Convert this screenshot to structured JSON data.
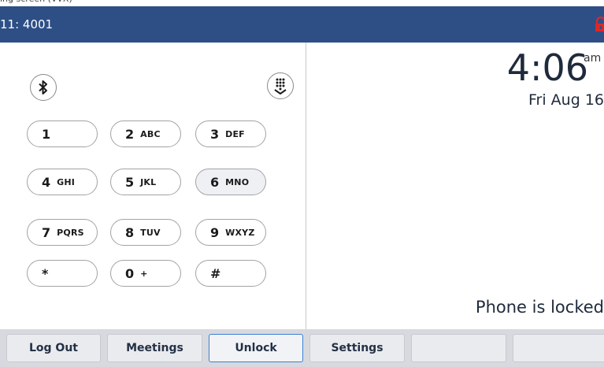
{
  "status_bar": {
    "line_label": "11: 4001",
    "lock_icon": "padlock-icon",
    "background": "#2d4f86",
    "lock_color": "#e02626"
  },
  "dialpad": {
    "bluetooth_icon": "bluetooth-icon",
    "keypad_icon": "dialpad-collapse-icon",
    "keys": [
      {
        "digit": "1",
        "letters": ""
      },
      {
        "digit": "2",
        "letters": "ABC"
      },
      {
        "digit": "3",
        "letters": "DEF"
      },
      {
        "digit": "4",
        "letters": "GHI"
      },
      {
        "digit": "5",
        "letters": "JKL"
      },
      {
        "digit": "6",
        "letters": "MNO"
      },
      {
        "digit": "7",
        "letters": "PQRS"
      },
      {
        "digit": "8",
        "letters": "TUV"
      },
      {
        "digit": "9",
        "letters": "WXYZ"
      },
      {
        "digit": "*",
        "letters": ""
      },
      {
        "digit": "0",
        "letters": "+"
      },
      {
        "digit": "#",
        "letters": ""
      }
    ]
  },
  "clock": {
    "time": "4:06",
    "ampm": "am",
    "date": "Fri Aug 16"
  },
  "status_message": "Phone is locked",
  "softkeys": [
    {
      "label": "Log Out"
    },
    {
      "label": "Meetings"
    },
    {
      "label": "Unlock"
    },
    {
      "label": "Settings"
    },
    {
      "label": ""
    },
    {
      "label": ""
    }
  ],
  "accent_color": "#3d7fd6"
}
